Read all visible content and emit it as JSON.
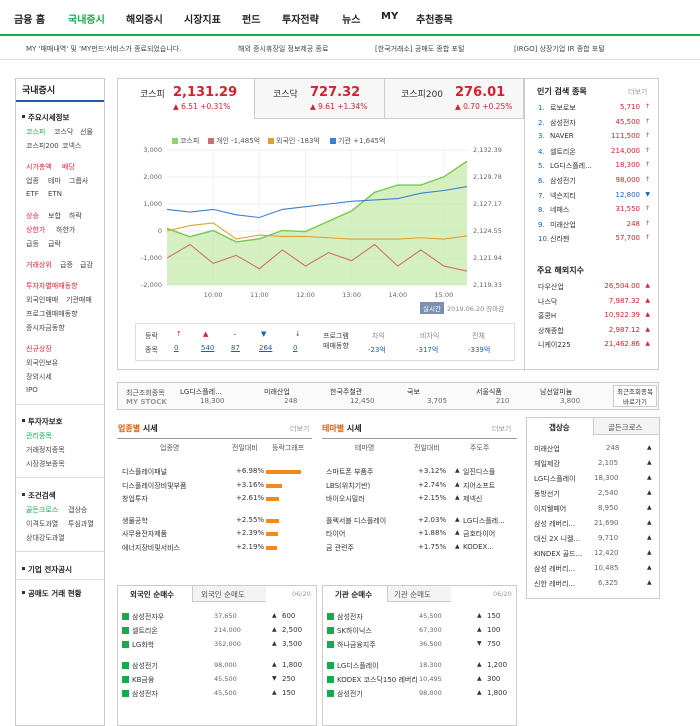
{
  "gnb": {
    "items": [
      "금융 홈",
      "국내증시",
      "해외증시",
      "시장지표",
      "펀드",
      "투자전략",
      "뉴스",
      "MY",
      "추천종목"
    ]
  },
  "notices": [
    "MY '매매내역' 및 'MY펀드'서비스가 종료되었습니다.",
    "해외 증시휴장일 정보제공 종료",
    "[한국거래소] 공매도 종합 포털",
    "[IRGO] 상장기업 IR 종합 포털"
  ],
  "sidebar": {
    "title": "국내증시",
    "groups": [
      {
        "head": "주요시세정보",
        "links": [
          "코스피",
          "코스닥",
          "선물",
          "코스피200",
          "코넥스"
        ]
      },
      {
        "head": "",
        "links": [
          "시가총액",
          "배당",
          "업종",
          "테마",
          "그룹사",
          "ETF",
          "ETN"
        ]
      },
      {
        "head": "",
        "links": [
          "상승",
          "보합",
          "하락",
          "상한가",
          "하한가",
          "급등",
          "급락"
        ]
      },
      {
        "head": "",
        "links": [
          "거래상위",
          "급증",
          "급감"
        ]
      },
      {
        "head": "",
        "links": [
          "투자자별매매동향",
          "외국인매매",
          "기관매매",
          "프로그램매매동향",
          "증시자금동향"
        ]
      },
      {
        "head": "",
        "links": [
          "신규상장",
          "외국인보유",
          "장외시세",
          "IPO"
        ]
      },
      {
        "head": "투자자보호",
        "links": [
          "관리종목",
          "거래정지종목",
          "시장경보종목"
        ]
      },
      {
        "head": "조건검색",
        "links": [
          "골든크로스",
          "갭상승",
          "이격도과열",
          "투심과열",
          "상대강도과열"
        ]
      },
      {
        "head": "기업 전자공시",
        "links": []
      },
      {
        "head": "공매도 거래 현황",
        "links": []
      }
    ]
  },
  "indices": [
    {
      "name": "코스피",
      "value": "2,131.29",
      "change": "▲ 6.51 +0.31%"
    },
    {
      "name": "코스닥",
      "value": "727.32",
      "change": "▲ 9.61 +1.34%"
    },
    {
      "name": "코스피200",
      "value": "276.01",
      "change": "▲ 0.70 +0.25%"
    }
  ],
  "chart": {
    "legend": [
      "코스피",
      "개인 -1,485억",
      "외국인 -183억",
      "기관 +1,645억"
    ],
    "colors": {
      "kospi": "#8fd16a",
      "individual": "#d07070",
      "foreign": "#e0a030",
      "institution": "#3a7fd0"
    },
    "timestamp_label": "실시간",
    "timestamp": "2019.06.20 장마감"
  },
  "chart_data": {
    "type": "area",
    "x": [
      "09:00",
      "09:30",
      "10:00",
      "10:30",
      "11:00",
      "11:30",
      "12:00",
      "12:30",
      "13:00",
      "13:30",
      "14:00",
      "14:30",
      "15:00",
      "15:30"
    ],
    "xticks": [
      "10:00",
      "11:00",
      "12:00",
      "13:00",
      "14:00",
      "15:00"
    ],
    "left_ticks": [
      "3,000",
      "2,000",
      "1,000",
      "0",
      "-1,000",
      "-2,000"
    ],
    "right_ticks": [
      "2,132.39",
      "2,129.78",
      "2,127.17",
      "2,124.55",
      "2,121.94",
      "2,119.33"
    ],
    "ylim_left": [
      -2000,
      3000
    ],
    "ylim_right": [
      2119.33,
      2132.39
    ],
    "series": [
      {
        "name": "코스피",
        "axis": "right",
        "values": [
          2124.8,
          2124.0,
          2124.6,
          2123.5,
          2123.8,
          2124.6,
          2124.5,
          2125.5,
          2126.5,
          2128.3,
          2129.0,
          2129.0,
          2129.8,
          2131.3
        ]
      },
      {
        "name": "개인",
        "values": [
          -1000,
          -500,
          -1200,
          -900,
          -1400,
          -700,
          -1300,
          -800,
          -1100,
          -500,
          -1300,
          -700,
          -1300,
          -1485
        ]
      },
      {
        "name": "외국인",
        "values": [
          0,
          200,
          300,
          -300,
          -150,
          -200,
          -200,
          -250,
          -300,
          -300,
          -300,
          -250,
          -300,
          -183
        ]
      },
      {
        "name": "기관",
        "values": [
          800,
          700,
          800,
          600,
          500,
          800,
          900,
          1000,
          1100,
          1150,
          1200,
          1400,
          1500,
          1645
        ]
      }
    ]
  },
  "stats": {
    "labels": [
      "등락",
      "종목"
    ],
    "items": [
      {
        "arrow": "↑",
        "value": "0"
      },
      {
        "arrow": "▲",
        "value": "540"
      },
      {
        "arrow": "–",
        "value": "87"
      },
      {
        "arrow": "▼",
        "value": "264"
      },
      {
        "arrow": "↓",
        "value": "0"
      }
    ],
    "program_label": "프로그램 매매동향",
    "program": [
      {
        "label": "차익",
        "value": "-23억"
      },
      {
        "label": "비차익",
        "value": "-317억"
      },
      {
        "label": "전체",
        "value": "-339억"
      }
    ]
  },
  "popular": {
    "title": "인기 검색 종목",
    "more": "더보기",
    "items": [
      {
        "rank": "1.",
        "name": "로보로보",
        "value": "5,710",
        "dir": "up"
      },
      {
        "rank": "2.",
        "name": "삼성전자",
        "value": "45,500",
        "dir": "up"
      },
      {
        "rank": "3.",
        "name": "NAVER",
        "value": "111,500",
        "dir": "up"
      },
      {
        "rank": "4.",
        "name": "셀트리온",
        "value": "214,000",
        "dir": "up"
      },
      {
        "rank": "5.",
        "name": "LG디스플레...",
        "value": "18,300",
        "dir": "up"
      },
      {
        "rank": "6.",
        "name": "삼성전기",
        "value": "98,000",
        "dir": "up"
      },
      {
        "rank": "7.",
        "name": "넥슨지티",
        "value": "12,800",
        "dir": "dn"
      },
      {
        "rank": "8.",
        "name": "네패스",
        "value": "31,550",
        "dir": "up"
      },
      {
        "rank": "9.",
        "name": "미래산업",
        "value": "248",
        "dir": "up"
      },
      {
        "rank": "10.",
        "name": "신라젠",
        "value": "57,700",
        "dir": "up"
      }
    ]
  },
  "overseas": {
    "title": "주요 해외지수",
    "items": [
      {
        "name": "다우산업",
        "value": "26,504.00"
      },
      {
        "name": "나스닥",
        "value": "7,987.32"
      },
      {
        "name": "홍콩H",
        "value": "10,922.39"
      },
      {
        "name": "상해종합",
        "value": "2,987.12"
      },
      {
        "name": "니케이225",
        "value": "21,462.86"
      }
    ]
  },
  "mystock": {
    "label1": "최근조회종목",
    "label2": "MY STOCK",
    "items": [
      {
        "name": "LG디스플레...",
        "price": "18,300"
      },
      {
        "name": "미래산업",
        "price": "248"
      },
      {
        "name": "한국주철관",
        "price": "12,450"
      },
      {
        "name": "국보",
        "price": "3,705"
      },
      {
        "name": "서울식품",
        "price": "210"
      },
      {
        "name": "남선알미늄",
        "price": "3,800"
      }
    ],
    "btn": "최근조회종목 바로가기"
  },
  "sector": {
    "title_b": "업종별",
    "title": "시세",
    "more": "더보기",
    "headers": [
      "업종명",
      "전일대비",
      "등락그래프"
    ],
    "rows": [
      {
        "name": "디스플레이패널",
        "pct": "+6.98%",
        "bar": 6.98
      },
      {
        "name": "디스플레이장비및부품",
        "pct": "+3.16%",
        "bar": 3.16
      },
      {
        "name": "창업투자",
        "pct": "+2.61%",
        "bar": 2.61
      },
      {
        "name": "생물공학",
        "pct": "+2.55%",
        "bar": 2.55
      },
      {
        "name": "사무용전자제품",
        "pct": "+2.39%",
        "bar": 2.39
      },
      {
        "name": "에너지장비및서비스",
        "pct": "+2.19%",
        "bar": 2.19
      }
    ]
  },
  "theme": {
    "title_b": "테마별",
    "title": "시세",
    "more": "더보기",
    "headers": [
      "테마명",
      "전일대비",
      "주도주"
    ],
    "rows": [
      {
        "name": "스마트폰 부품주",
        "pct": "+3.12%",
        "lead": "일진디스플"
      },
      {
        "name": "LBS(위치기반)",
        "pct": "+2.74%",
        "lead": "지어소프트"
      },
      {
        "name": "바이오시밀러",
        "pct": "+2.15%",
        "lead": "제넥신"
      },
      {
        "name": "플렉서블 디스플레이",
        "pct": "+2.03%",
        "lead": "LG디스플레..."
      },
      {
        "name": "타이어",
        "pct": "+1.88%",
        "lead": "금호타이어"
      },
      {
        "name": "금 관련주",
        "pct": "+1.75%",
        "lead": "KODEX..."
      }
    ]
  },
  "gap": {
    "tabs": [
      "갭상승",
      "골든크로스"
    ],
    "items": [
      {
        "name": "미래산업",
        "value": "248"
      },
      {
        "name": "체일제강",
        "value": "2,105"
      },
      {
        "name": "LG디스플레이",
        "value": "18,300"
      },
      {
        "name": "동방선기",
        "value": "2,540"
      },
      {
        "name": "이지웰페어",
        "value": "8,950"
      },
      {
        "name": "삼성 레버리...",
        "value": "21,690"
      },
      {
        "name": "대신 2X 니켈...",
        "value": "9,710"
      },
      {
        "name": "KINDEX 골드...",
        "value": "12,420"
      },
      {
        "name": "삼성 레버리...",
        "value": "10,485"
      },
      {
        "name": "신한 레버리...",
        "value": "6,325"
      }
    ]
  },
  "foreign": {
    "tabs": [
      "외국인 순매수",
      "외국인 순매도"
    ],
    "date": "06/20",
    "rows": [
      {
        "name": "삼성전자우",
        "price": "37,650",
        "chg": "600",
        "dir": "up"
      },
      {
        "name": "셀트리온",
        "price": "214,000",
        "chg": "2,500",
        "dir": "up"
      },
      {
        "name": "LG화학",
        "price": "352,000",
        "chg": "3,500",
        "dir": "up"
      },
      {
        "name": "삼성전기",
        "price": "98,000",
        "chg": "1,800",
        "dir": "up"
      },
      {
        "name": "KB금융",
        "price": "45,500",
        "chg": "250",
        "dir": "dn"
      },
      {
        "name": "삼성전자",
        "price": "45,500",
        "chg": "150",
        "dir": "up"
      }
    ]
  },
  "inst": {
    "tabs": [
      "기관 순매수",
      "기관 순매도"
    ],
    "date": "06/20",
    "rows": [
      {
        "name": "삼성전자",
        "price": "45,500",
        "chg": "150",
        "dir": "up"
      },
      {
        "name": "SK하이닉스",
        "price": "67,300",
        "chg": "100",
        "dir": "up"
      },
      {
        "name": "하나금융지주",
        "price": "36,500",
        "chg": "750",
        "dir": "dn"
      },
      {
        "name": "LG디스플레이",
        "price": "18,300",
        "chg": "1,200",
        "dir": "up"
      },
      {
        "name": "KODEX 코스닥150 레버리지",
        "price": "10,495",
        "chg": "300",
        "dir": "up"
      },
      {
        "name": "삼성전기",
        "price": "98,000",
        "chg": "1,800",
        "dir": "up"
      }
    ]
  }
}
